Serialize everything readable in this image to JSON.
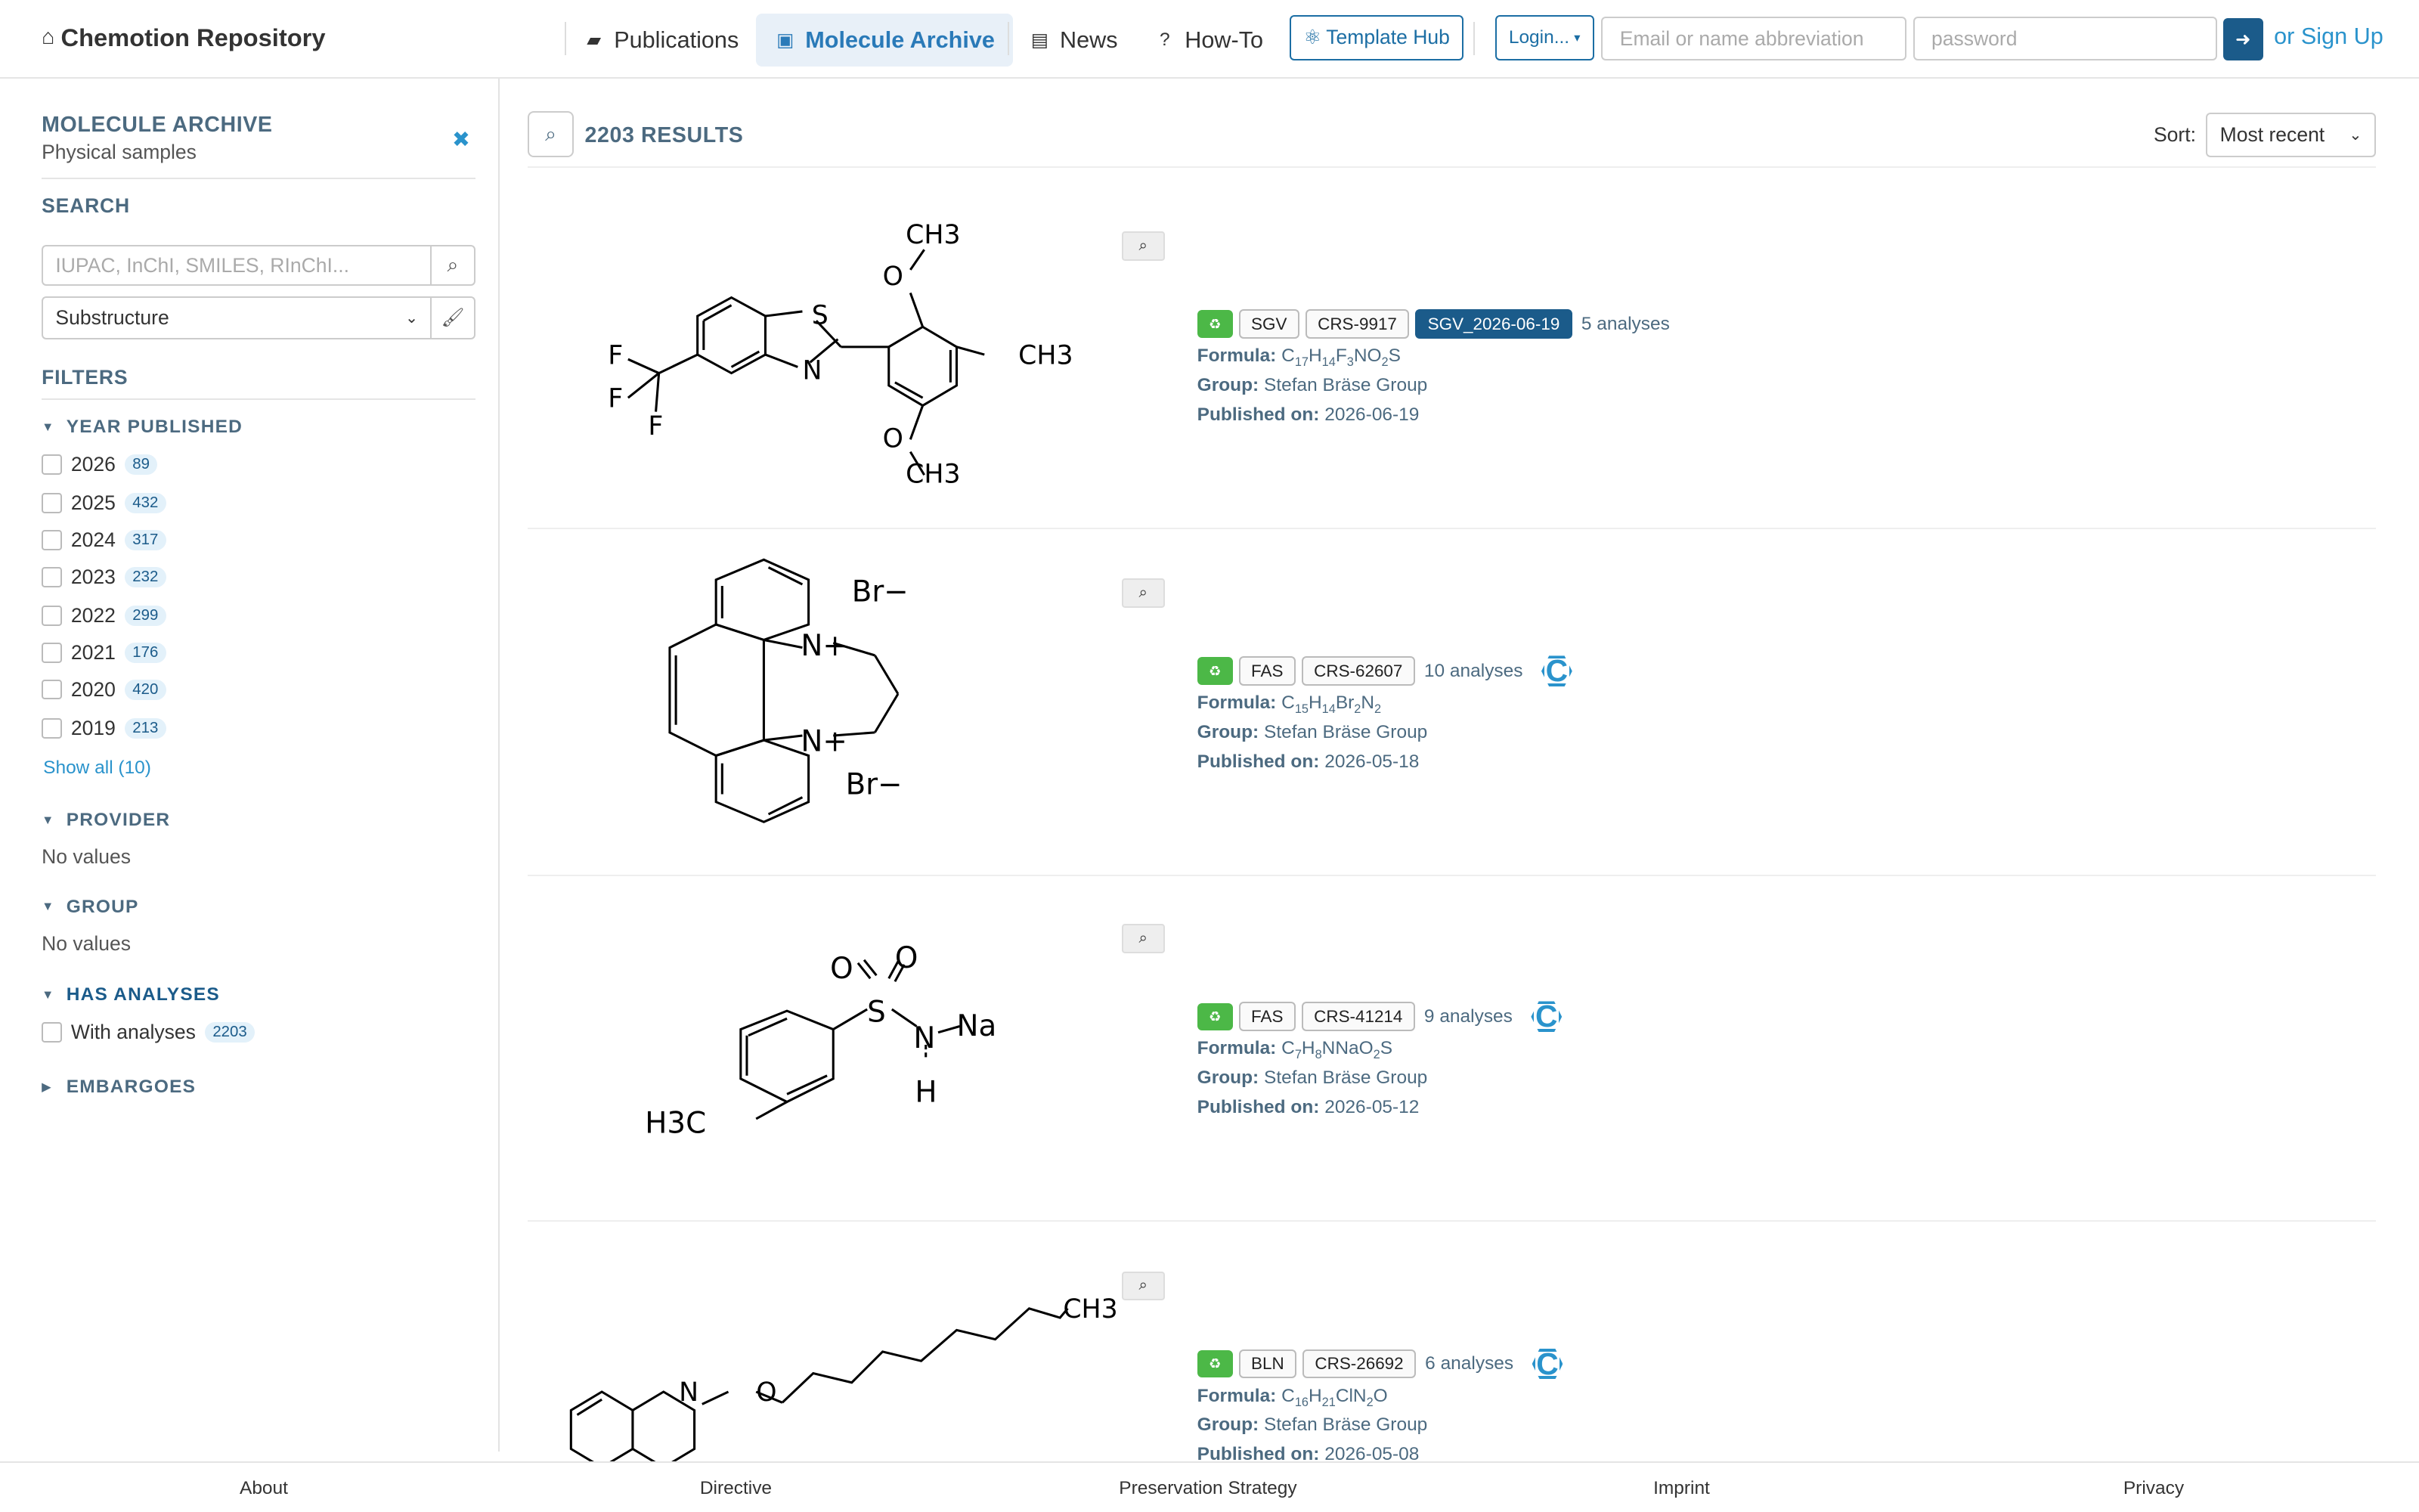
{
  "navbar": {
    "brand": "Chemotion Repository",
    "links": [
      {
        "label": "Publications",
        "icon": "book-icon"
      },
      {
        "label": "Molecule Archive",
        "icon": "archive-icon"
      },
      {
        "label": "News",
        "icon": "newspaper-icon"
      },
      {
        "label": "How-To",
        "icon": "question-icon"
      }
    ],
    "template_hub": "Template Hub",
    "login": "Login...",
    "email_placeholder": "Email or name abbreviation",
    "password_placeholder": "password",
    "signup": "or Sign Up"
  },
  "sidebar": {
    "title": "MOLECULE ARCHIVE",
    "subtitle": "Physical samples",
    "search_heading": "SEARCH",
    "search_placeholder": "IUPAC, InChI, SMILES, RInChI...",
    "search_mode": "Substructure",
    "filters_heading": "FILTERS",
    "year_heading": "YEAR PUBLISHED",
    "years": [
      {
        "year": "2026",
        "count": "89"
      },
      {
        "year": "2025",
        "count": "432"
      },
      {
        "year": "2024",
        "count": "317"
      },
      {
        "year": "2023",
        "count": "232"
      },
      {
        "year": "2022",
        "count": "299"
      },
      {
        "year": "2021",
        "count": "176"
      },
      {
        "year": "2020",
        "count": "420"
      },
      {
        "year": "2019",
        "count": "213"
      }
    ],
    "show_all": "Show all (10)",
    "provider_heading": "PROVIDER",
    "provider_values": "No values",
    "group_heading": "GROUP",
    "group_values": "No values",
    "analyses_heading": "HAS ANALYSES",
    "analyses_option": "With analyses",
    "analyses_count": "2203",
    "embargoes_heading": "EMBARGOES"
  },
  "results": {
    "count": "2203 RESULTS",
    "sort_label": "Sort:",
    "sort_value": "Most recent",
    "labels": {
      "formula": "Formula:",
      "group": "Group:",
      "published": "Published on:"
    },
    "items": [
      {
        "tag1": "SGV",
        "id": "CRS-9917",
        "extra": "SGV_2026-06-19",
        "analyses": "5 analyses",
        "formula": [
          [
            "C",
            "17"
          ],
          [
            "H",
            "14"
          ],
          [
            "F",
            "3"
          ],
          [
            "NO",
            "2"
          ],
          [
            "S",
            ""
          ]
        ],
        "group": "Stefan Bräse Group",
        "published": "2026-06-19"
      },
      {
        "tag1": "FAS",
        "id": "CRS-62607",
        "analyses": "10 analyses",
        "formula": [
          [
            "C",
            "15"
          ],
          [
            "H",
            "14"
          ],
          [
            "Br",
            "2"
          ],
          [
            "N",
            "2"
          ]
        ],
        "group": "Stefan Bräse Group",
        "published": "2026-05-18"
      },
      {
        "tag1": "FAS",
        "id": "CRS-41214",
        "analyses": "9 analyses",
        "formula": [
          [
            "C",
            "7"
          ],
          [
            "H",
            "8"
          ],
          [
            "NNaO",
            "2"
          ],
          [
            "S",
            ""
          ]
        ],
        "group": "Stefan Bräse Group",
        "published": "2026-05-12"
      },
      {
        "tag1": "BLN",
        "id": "CRS-26692",
        "analyses": "6 analyses",
        "formula": [
          [
            "C",
            "16"
          ],
          [
            "H",
            "21"
          ],
          [
            "ClN",
            "2"
          ],
          [
            "O",
            ""
          ]
        ],
        "group": "Stefan Bräse Group",
        "published": "2026-05-08"
      }
    ],
    "structures": [
      [
        "CH3",
        "S",
        "N",
        "O",
        "O",
        "CH3",
        "CH3",
        "F",
        "F",
        "F"
      ],
      [
        "Br−",
        "N+",
        "N+",
        "Br−"
      ],
      [
        "O",
        "O",
        "S",
        "N",
        "Na",
        "H",
        "H3C"
      ],
      [
        "N",
        "O",
        "CH3"
      ]
    ],
    "cc_symbol": "C"
  },
  "footer": [
    "About",
    "Directive",
    "Preservation Strategy",
    "Imprint",
    "Privacy"
  ]
}
